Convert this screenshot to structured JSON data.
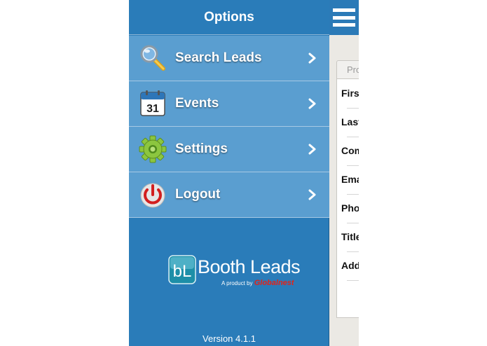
{
  "menu": {
    "title": "Options",
    "items": [
      {
        "label": "Search Leads",
        "icon": "magnifier-icon"
      },
      {
        "label": "Events",
        "icon": "calendar-icon",
        "calendar_day": "31"
      },
      {
        "label": "Settings",
        "icon": "gear-icon"
      },
      {
        "label": "Logout",
        "icon": "power-icon"
      }
    ],
    "logo": {
      "mark": "bL",
      "name": "Booth Leads",
      "tagline": "A product by",
      "brand": "Globalnest"
    },
    "version": "Version 4.1.1"
  },
  "background": {
    "tab_label": "Pro",
    "fields": [
      "First",
      "Last",
      "Com",
      "Ema",
      "Phon",
      "Title",
      "Add"
    ]
  },
  "colors": {
    "header_blue": "#2a7cb9",
    "item_blue": "#5a9ed0",
    "accent_red": "#e2231a"
  }
}
